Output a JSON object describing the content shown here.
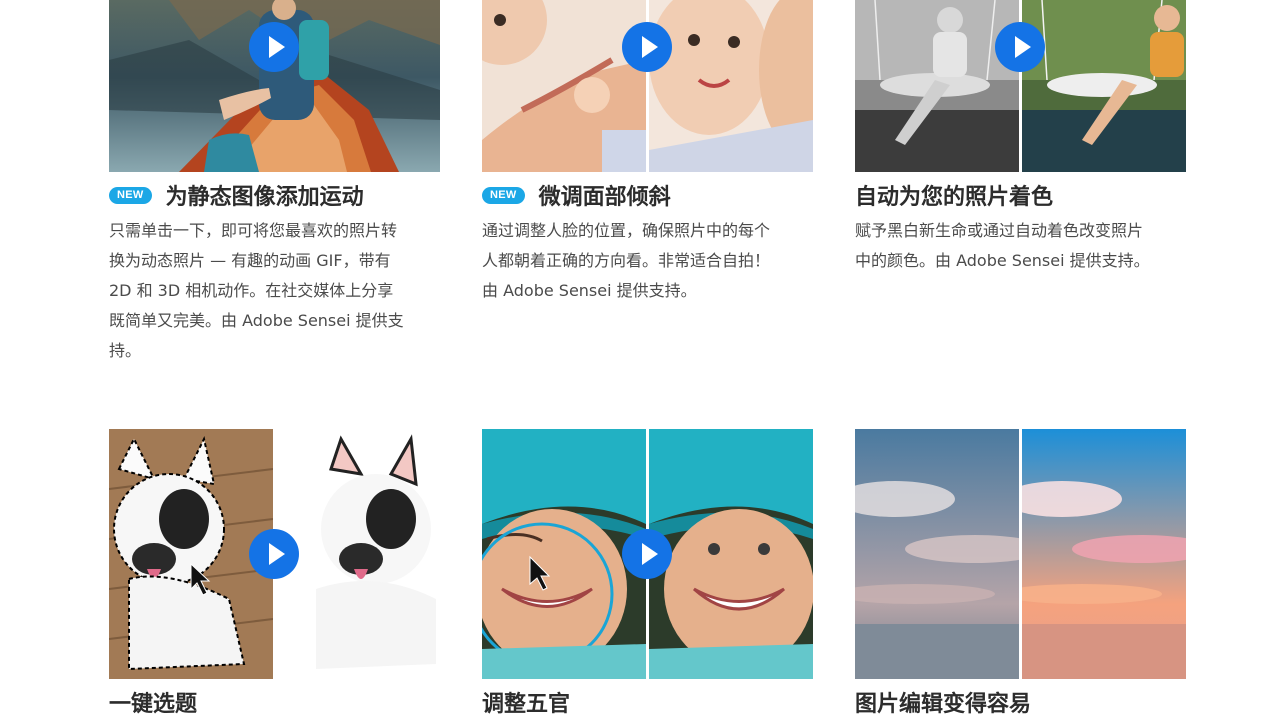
{
  "features": [
    {
      "badge": "NEW",
      "title": "为静态图像添加运动",
      "description": "只需单击一下，即可将您最喜欢的照片转换为动态照片 — 有趣的动画 GIF，带有 2D 和 3D 相机动作。在社交媒体上分享既简单又完美。由 Adobe Sensei 提供支持。",
      "image": "lake-boat-photo",
      "has_play": true
    },
    {
      "badge": "NEW",
      "title": "微调面部倾斜",
      "description": "通过调整人脸的位置，确保照片中的每个人都朝着正确的方向看。非常适合自拍！由 Adobe Sensei 提供支持。",
      "image": "baby-faces-before-after",
      "has_play": true
    },
    {
      "title": "自动为您的照片着色",
      "description": "赋予黑白新生命或通过自动着色改变照片中的颜色。由 Adobe Sensei 提供支持。",
      "image": "swing-woman-bw-color",
      "has_play": true
    },
    {
      "title": "一键选题",
      "image": "french-bulldog-selection",
      "has_play": true
    },
    {
      "title": "调整五官",
      "image": "girl-blue-hat-before-after",
      "has_play": true
    },
    {
      "title": "图片编辑变得容易",
      "image": "sky-sunset-before-after",
      "has_play": false
    }
  ],
  "colors": {
    "play_button": "#1473e6",
    "new_badge": "#1ba7e6",
    "title_text": "#2c2c2c",
    "body_text": "#4b4b4b"
  }
}
